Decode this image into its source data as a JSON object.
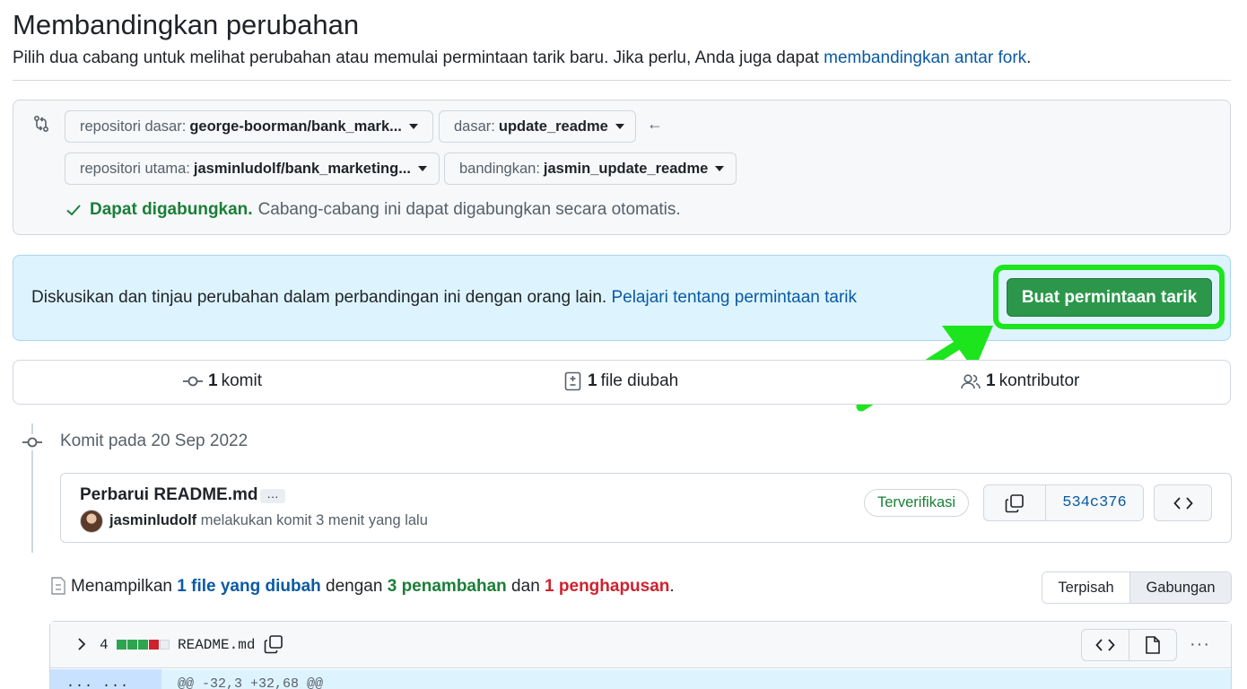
{
  "header": {
    "title": "Membandingkan perubahan",
    "description": "Pilih dua cabang untuk melihat perubahan atau memulai permintaan tarik baru. Jika perlu, Anda juga dapat ",
    "description_link": "membandingkan antar fork",
    "description_end": "."
  },
  "range": {
    "base_repo_label": "repositori dasar:",
    "base_repo_value": "george-boorman/bank_mark...",
    "base_label": "dasar:",
    "base_value": "update_readme",
    "head_repo_label": "repositori utama:",
    "head_repo_value": "jasminludolf/bank_marketing...",
    "compare_label": "bandingkan:",
    "compare_value": "jasmin_update_readme",
    "arrow": "←",
    "merge_status": "Dapat digabungkan.",
    "merge_text": "Cabang-cabang ini dapat digabungkan secara otomatis."
  },
  "blank_slate": {
    "text": "Diskusikan dan tinjau perubahan dalam perbandingan ini dengan orang lain. ",
    "link": "Pelajari tentang permintaan tarik",
    "button": "Buat permintaan tarik"
  },
  "summary": {
    "commits_count": "1",
    "commits_label": "komit",
    "files_count": "1",
    "files_label": "file diubah",
    "contributors_count": "1",
    "contributors_label": "kontributor"
  },
  "timeline": {
    "date_text": "Komit pada 20 Sep 2022"
  },
  "commit": {
    "title": "Perbarui README.md",
    "ellipsis": "···",
    "author": "jasminludolf",
    "meta": "melakukan komit 3 menit yang lalu",
    "verified": "Terverifikasi",
    "sha": "534c376"
  },
  "diff": {
    "prefix": "Menampilkan ",
    "files": "1 file yang diubah",
    "mid1": " dengan ",
    "additions": "3 penambahan",
    "mid2": " dan ",
    "deletions": "1 penghapusan",
    "end": ".",
    "view_split": "Terpisah",
    "view_unified": "Gabungan"
  },
  "file": {
    "count": "4",
    "name": "README.md",
    "kebab": "···",
    "hunk_gutter": "···  ···",
    "hunk": "@@ -32,3 +32,68 @@"
  },
  "colors": {
    "accent_green": "#2c974b",
    "highlight": "#1de51d",
    "link": "#0a5aa3"
  }
}
